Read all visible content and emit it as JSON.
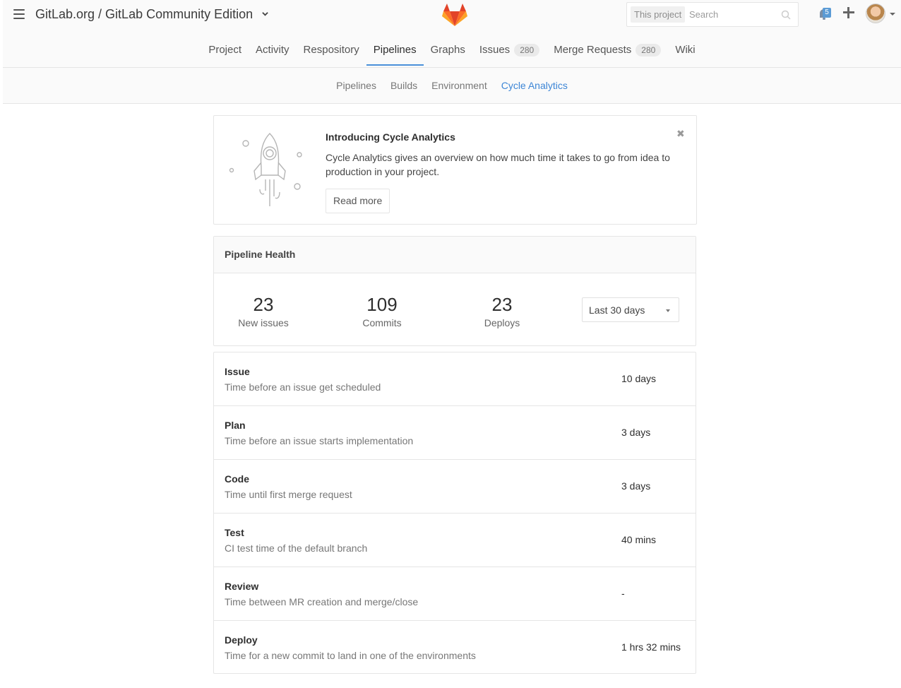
{
  "header": {
    "breadcrumb": "GitLab.org / GitLab Community Edition",
    "search_scope": "This project",
    "search_placeholder": "Search",
    "notification_count": "5"
  },
  "main_nav": [
    {
      "label": "Project",
      "count": null,
      "active": false
    },
    {
      "label": "Activity",
      "count": null,
      "active": false
    },
    {
      "label": "Respository",
      "count": null,
      "active": false
    },
    {
      "label": "Pipelines",
      "count": null,
      "active": true
    },
    {
      "label": "Graphs",
      "count": null,
      "active": false
    },
    {
      "label": "Issues",
      "count": "280",
      "active": false
    },
    {
      "label": "Merge Requests",
      "count": "280",
      "active": false
    },
    {
      "label": "Wiki",
      "count": null,
      "active": false
    }
  ],
  "sub_nav": [
    {
      "label": "Pipelines",
      "active": false
    },
    {
      "label": "Builds",
      "active": false
    },
    {
      "label": "Environment",
      "active": false
    },
    {
      "label": "Cycle Analytics",
      "active": true
    }
  ],
  "intro": {
    "title": "Introducing Cycle Analytics",
    "description": "Cycle Analytics gives an overview on how much time it takes to go from idea to production in your project.",
    "button": "Read more",
    "close": "✖"
  },
  "health": {
    "title": "Pipeline Health",
    "stats": [
      {
        "value": "23",
        "label": "New issues"
      },
      {
        "value": "109",
        "label": "Commits"
      },
      {
        "value": "23",
        "label": "Deploys"
      }
    ],
    "range": "Last 30 days"
  },
  "stages": [
    {
      "name": "Issue",
      "description": "Time before an issue get scheduled",
      "value": "10 days"
    },
    {
      "name": "Plan",
      "description": "Time before an issue starts implementation",
      "value": "3 days"
    },
    {
      "name": "Code",
      "description": "Time until first merge request",
      "value": "3 days"
    },
    {
      "name": "Test",
      "description": "CI test time of the default branch",
      "value": "40 mins"
    },
    {
      "name": "Review",
      "description": "Time between MR creation and merge/close",
      "value": "-"
    },
    {
      "name": "Deploy",
      "description": "Time for a new commit to land in one of the environments",
      "value": "1 hrs 32 mins"
    }
  ],
  "colors": {
    "accent": "#4a90d9",
    "active_subtab": "#3d86d6",
    "logo_orange": "#e24329",
    "logo_light": "#fc6d26",
    "logo_amber": "#fca326"
  }
}
